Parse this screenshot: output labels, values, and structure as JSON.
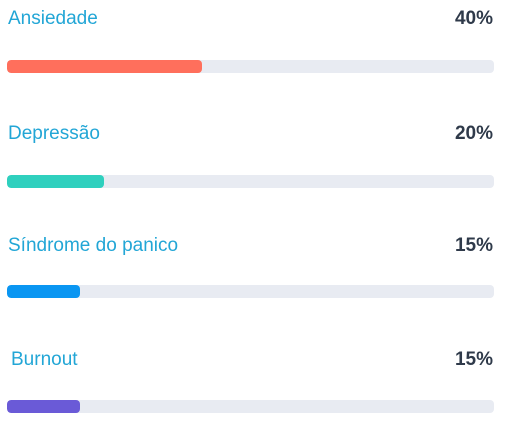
{
  "items": [
    {
      "label": "Ansiedade",
      "percent_text": "40%",
      "value": 40,
      "color": "#ff6f5c"
    },
    {
      "label": "Depressão",
      "percent_text": "20%",
      "value": 20,
      "color": "#2fd0be"
    },
    {
      "label": "Síndrome do panico",
      "percent_text": "15%",
      "value": 15,
      "color": "#0a96f2"
    },
    {
      "label": "Burnout",
      "percent_text": "15%",
      "value": 15,
      "color": "#6a5ad7"
    }
  ]
}
